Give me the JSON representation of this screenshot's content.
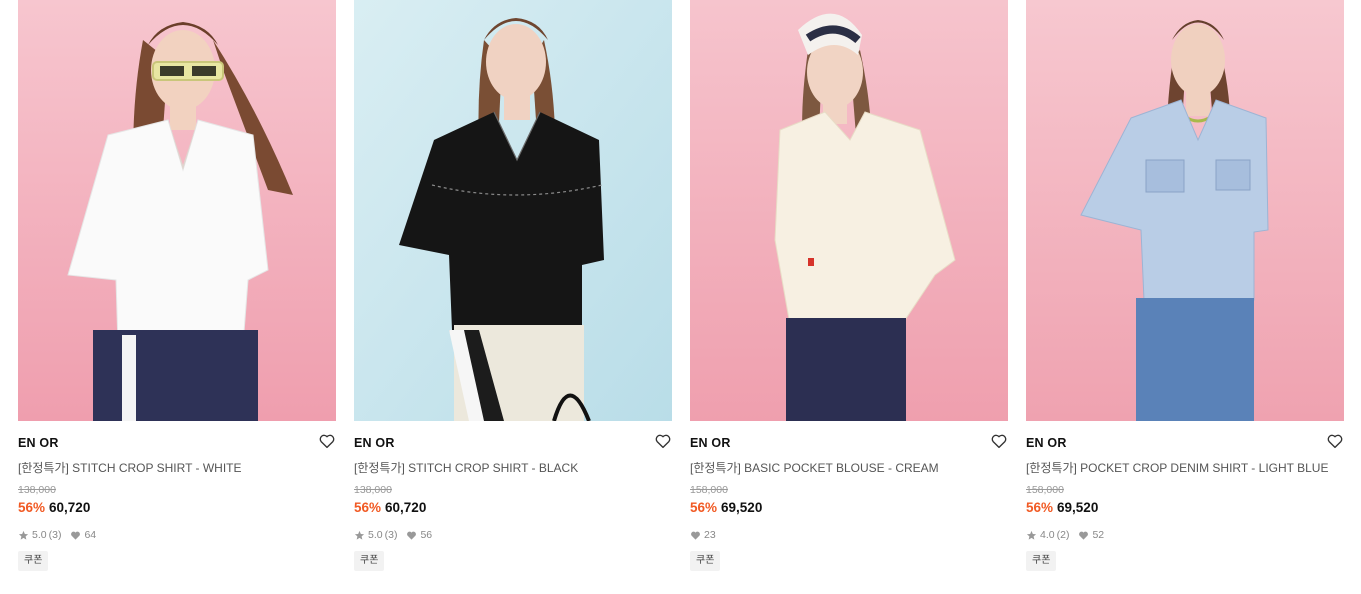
{
  "colors": {
    "discount": "#f15a24",
    "pink_backdrop": "#f2aeb9",
    "blue_backdrop": "#cfe6ee"
  },
  "icons": {
    "wish": "heart-outline-icon",
    "rating": "star-icon",
    "likes": "heart-filled-icon"
  },
  "products": [
    {
      "brand": "EN OR",
      "title": "[한정특가] STITCH CROP SHIRT - WHITE",
      "original_price": "138,000",
      "discount": "56%",
      "price": "60,720",
      "rating": "5.0",
      "reviews": "(3)",
      "likes": "64",
      "coupon": "쿠폰"
    },
    {
      "brand": "EN OR",
      "title": "[한정특가] STITCH CROP SHIRT - BLACK",
      "original_price": "138,000",
      "discount": "56%",
      "price": "60,720",
      "rating": "5.0",
      "reviews": "(3)",
      "likes": "56",
      "coupon": "쿠폰"
    },
    {
      "brand": "EN OR",
      "title": "[한정특가] BASIC POCKET BLOUSE - CREAM",
      "original_price": "158,000",
      "discount": "56%",
      "price": "69,520",
      "likes": "23",
      "coupon": "쿠폰"
    },
    {
      "brand": "EN OR",
      "title": "[한정특가] POCKET CROP DENIM SHIRT - LIGHT BLUE",
      "original_price": "158,000",
      "discount": "56%",
      "price": "69,520",
      "rating": "4.0",
      "reviews": "(2)",
      "likes": "52",
      "coupon": "쿠폰"
    }
  ]
}
